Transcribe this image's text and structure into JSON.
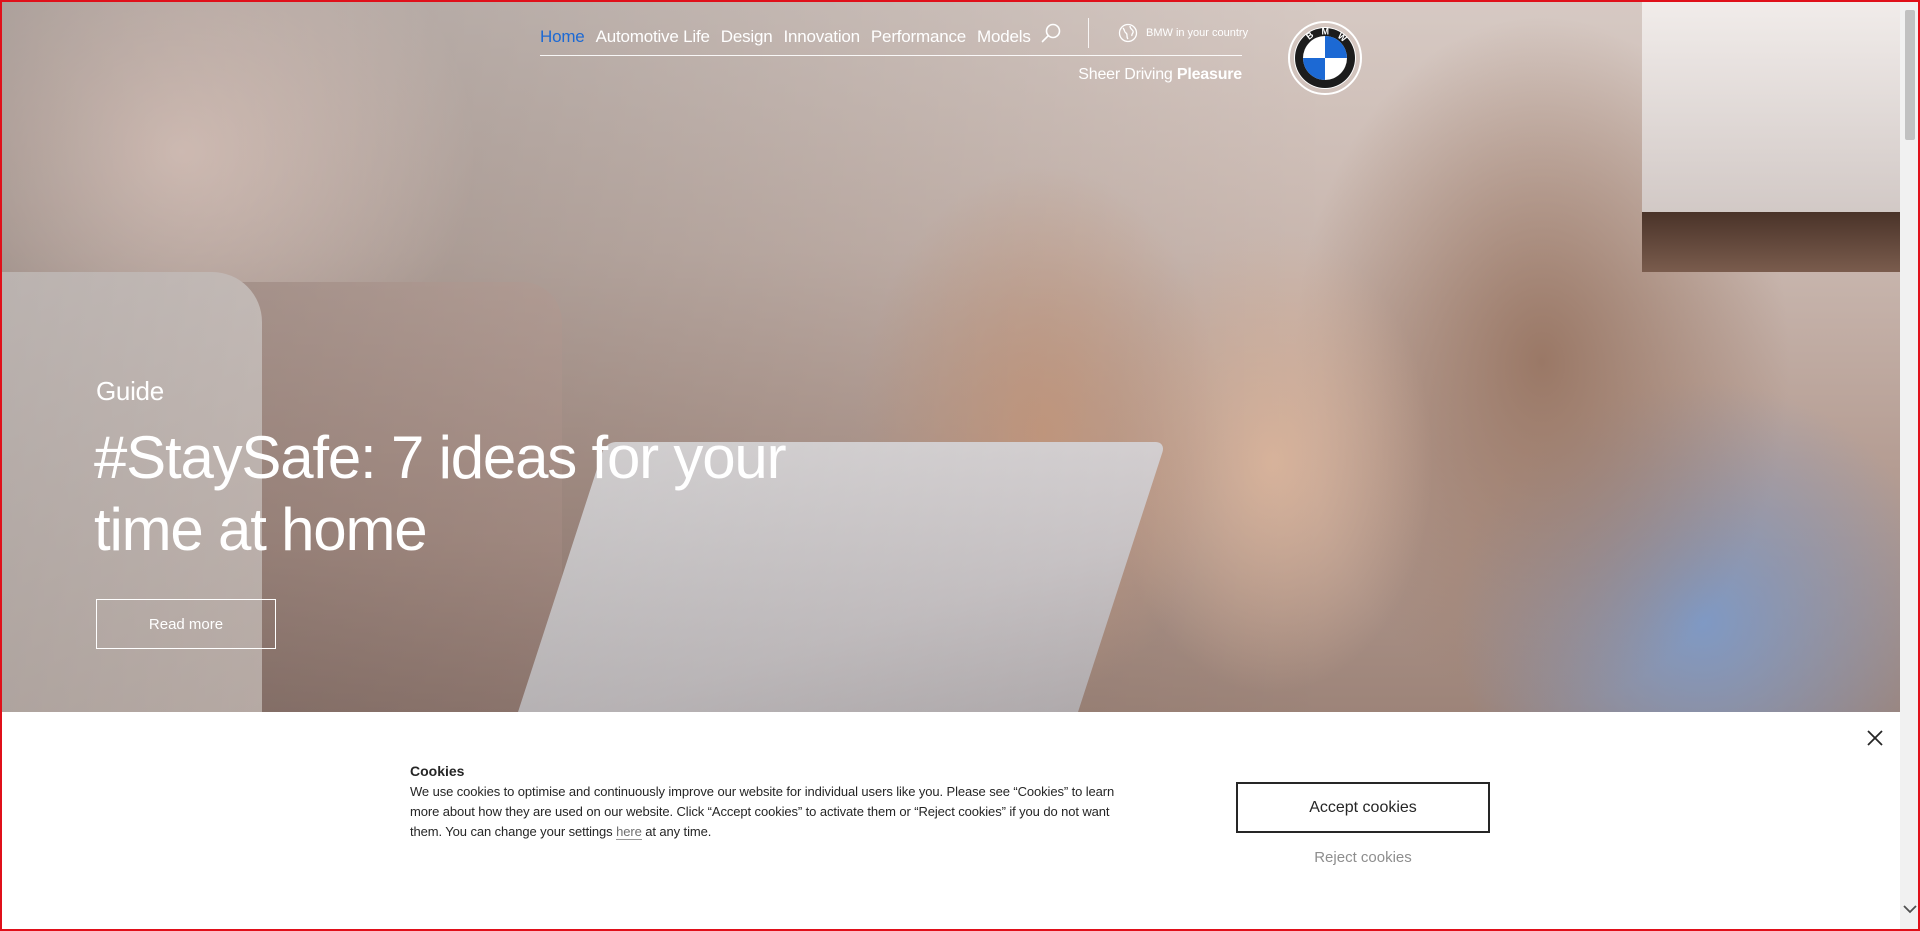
{
  "nav": {
    "items": [
      {
        "label": "Home",
        "active": true
      },
      {
        "label": "Automotive Life",
        "active": false
      },
      {
        "label": "Design",
        "active": false
      },
      {
        "label": "Innovation",
        "active": false
      },
      {
        "label": "Performance",
        "active": false
      },
      {
        "label": "Models",
        "active": false
      }
    ],
    "search_icon": "search-icon",
    "country_icon": "globe-icon",
    "country_label": "BMW in your country",
    "tagline_regular": "Sheer Driving",
    "tagline_bold": "Pleasure",
    "logo_icon": "bmw-roundel-logo",
    "logo_letters": "BMW"
  },
  "hero": {
    "eyebrow": "Guide",
    "headline": "#StaySafe: 7 ideas for your time at home",
    "cta_label": "Read more"
  },
  "cookie_banner": {
    "title": "Cookies",
    "text_before_link": "We use cookies to optimise and continuously improve our website for individual users like you. Please see “Cookies” to learn more about how they are used on our website. Click “Accept cookies” to activate them or “Reject cookies” if you do not want them. You can change your settings ",
    "link_text": "here",
    "text_after_link": " at any time.",
    "accept_label": "Accept cookies",
    "reject_label": "Reject cookies",
    "close_icon": "close-icon"
  },
  "colors": {
    "accent_blue": "#1c69d4",
    "window_border": "#e0101a",
    "text_dark": "#262626",
    "reject_gray": "#8e8e8e"
  }
}
